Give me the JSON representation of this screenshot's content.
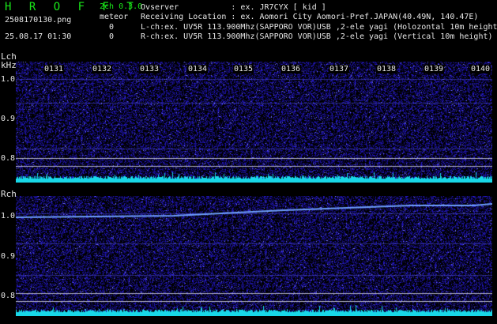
{
  "header": {
    "title": "H R O F F T",
    "version": "2ch 0.3.0",
    "mode": "meteor",
    "filename": "2508170130.png",
    "datetime": "25.08.17 01:30",
    "count_l": "0",
    "count_r": "0",
    "info_lines": [
      "Ovserver           : ex. JR7CYX [ kid ]",
      "Receiving Location : ex. Aomori City Aomori-Pref.JAPAN(40.49N, 140.47E)",
      "L-ch:ex. UV5R 113.900Mhz(SAPPORO VOR)USB ,2-ele yagi (Holozontal 10m height)",
      "R-ch:ex. UV5R 113.900Mhz(SAPPORO VOR)USB ,2-ele yagi (Vertical 10m height)"
    ]
  },
  "left_channel": {
    "label": "Lch",
    "unit": "kHz",
    "freq_ticks": [
      "1.0",
      "0.9",
      "0.8"
    ]
  },
  "right_channel": {
    "label": "Rch",
    "freq_ticks": [
      "1.0",
      "0.9",
      "0.8"
    ]
  },
  "time_labels": [
    "0131",
    "0132",
    "0133",
    "0134",
    "0135",
    "0136",
    "0137",
    "0138",
    "0139",
    "0140"
  ],
  "colors": {
    "background": "#000000",
    "title_green": "#19e619",
    "noise_blue": "#2a2ad8",
    "signal_cyan": "#18d8e8",
    "marker_line": "#b4b4c8"
  }
}
